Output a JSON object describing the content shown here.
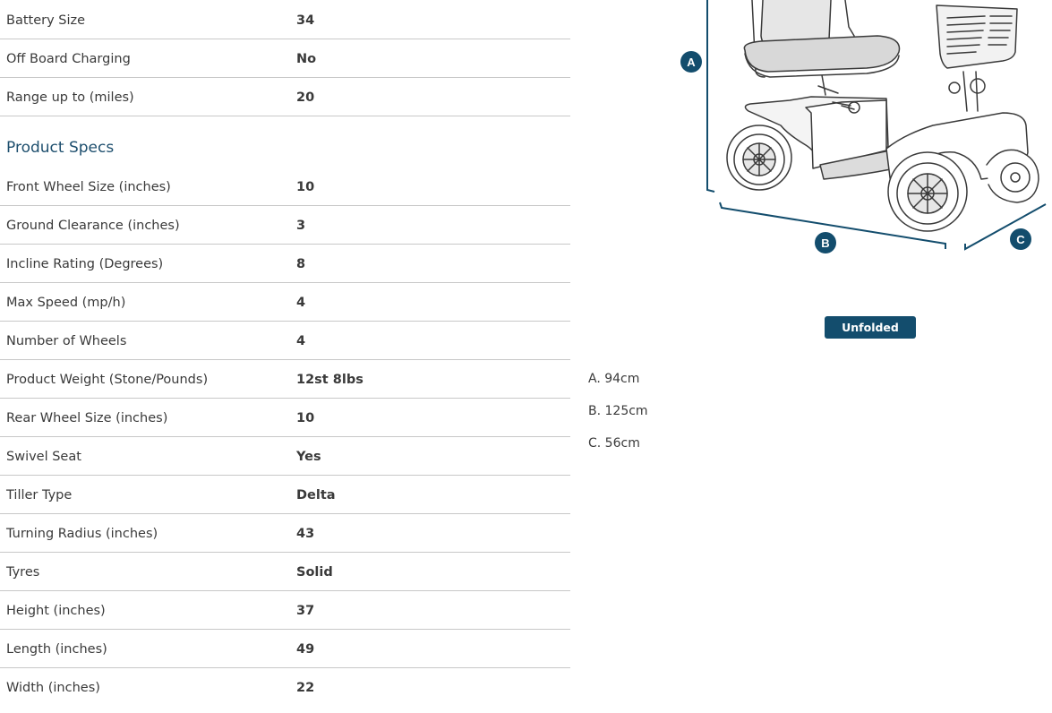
{
  "battery_specs": [
    {
      "label": "Battery Size",
      "value": "34"
    },
    {
      "label": "Off Board Charging",
      "value": "No"
    },
    {
      "label": "Range up to (miles)",
      "value": "20"
    }
  ],
  "product_specs_title": "Product Specs",
  "product_specs": [
    {
      "label": "Front Wheel Size (inches)",
      "value": "10"
    },
    {
      "label": "Ground Clearance (inches)",
      "value": "3"
    },
    {
      "label": "Incline Rating (Degrees)",
      "value": "8"
    },
    {
      "label": "Max Speed (mp/h)",
      "value": "4"
    },
    {
      "label": "Number of Wheels",
      "value": "4"
    },
    {
      "label": "Product Weight (Stone/Pounds)",
      "value": "12st 8lbs"
    },
    {
      "label": "Rear Wheel Size (inches)",
      "value": "10"
    },
    {
      "label": "Swivel Seat",
      "value": "Yes"
    },
    {
      "label": "Tiller Type",
      "value": "Delta"
    },
    {
      "label": "Turning Radius (inches)",
      "value": "43"
    },
    {
      "label": "Tyres",
      "value": "Solid"
    },
    {
      "label": "Height (inches)",
      "value": "37"
    },
    {
      "label": "Length (inches)",
      "value": "49"
    },
    {
      "label": "Width (inches)",
      "value": "22"
    }
  ],
  "diagram": {
    "markers": [
      "A",
      "B",
      "C"
    ],
    "badge": "Unfolded",
    "dimensions": [
      "A. 94cm",
      "B. 125cm",
      "C. 56cm"
    ]
  },
  "colors": {
    "accent": "#134d6d",
    "title": "#1e4f6e",
    "divider": "#c8c8c8"
  }
}
